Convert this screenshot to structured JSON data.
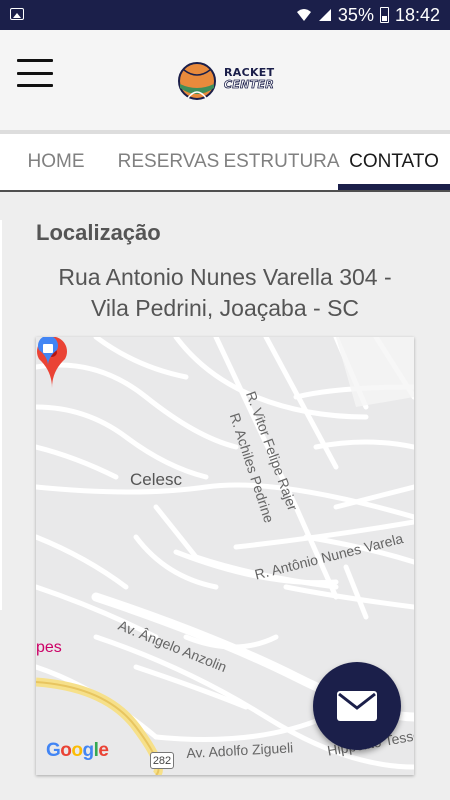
{
  "status_bar": {
    "battery": "35%",
    "time": "18:42"
  },
  "header": {
    "logo_line1": "RACKET",
    "logo_line2": "CENTER"
  },
  "tabs": [
    {
      "label": "HOME",
      "active": false
    },
    {
      "label": "RESERVAS",
      "active": false
    },
    {
      "label": "ESTRUTURA",
      "active": false
    },
    {
      "label": "CONTATO",
      "active": true
    }
  ],
  "location": {
    "title": "Localização",
    "address_line1": "Rua Antonio Nunes Varella 304 -",
    "address_line2": "Vila Pedrini, Joaçaba - SC"
  },
  "map": {
    "poi_celesc": "Celesc",
    "street_vitor": "R. Vitor Felipe Rajer",
    "street_achiles": "R. Achiles Pedrine",
    "street_antonio": "R. Antônio Nunes Varela",
    "street_angelo": "Av. Ângelo Anzolin",
    "street_adolfo": "Av. Adolfo Zigueli",
    "street_tesser": "Hippolito Tesser",
    "shop_partial": "pes",
    "route_number": "282",
    "attribution": "Google"
  },
  "colors": {
    "brand": "#1b1f4a",
    "pin": "#ea4335"
  },
  "icons": {
    "fab": "mail-icon",
    "menu": "hamburger-menu-icon"
  }
}
